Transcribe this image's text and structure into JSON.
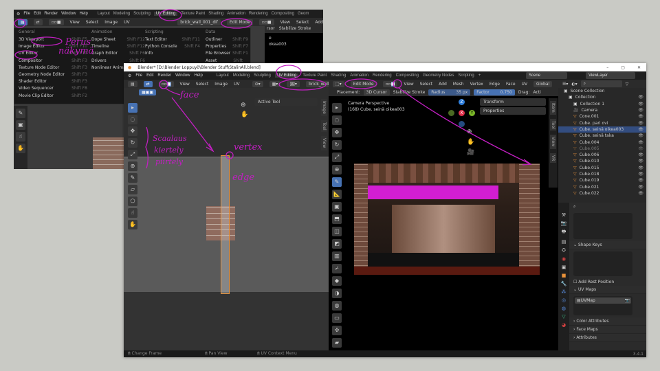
{
  "back_window": {
    "menu": [
      "File",
      "Edit",
      "Render",
      "Window",
      "Help"
    ],
    "workspaces": [
      "Layout",
      "Modeling",
      "Sculpting",
      "UV Editing",
      "Texture Paint",
      "Shading",
      "Animation",
      "Rendering",
      "Compositing",
      "Geom"
    ],
    "header": {
      "items": [
        "View",
        "Select",
        "Image",
        "UV"
      ],
      "image_name": "brick_wall_001_dif",
      "mode": "Edit Mode",
      "right_items": [
        "View",
        "Select",
        "Add"
      ],
      "cursor_text": "rsor",
      "stabilize": "Stabilize Stroke",
      "scene_text": [
        "e",
        "okea003"
      ]
    },
    "editor_menu": {
      "columns": [
        {
          "heading": "General",
          "items": [
            [
              "3D Viewport",
              "Shift F5"
            ],
            [
              "Image Editor",
              "Shift F10"
            ],
            [
              "UV Editor",
              "Shift F10"
            ],
            [
              "Compositor",
              "Shift F3"
            ],
            [
              "Texture Node Editor",
              "Shift F3"
            ],
            [
              "Geometry Node Editor",
              "Shift F3"
            ],
            [
              "Shader Editor",
              "Shift F3"
            ],
            [
              "Video Sequencer",
              "Shift F8"
            ],
            [
              "Movie Clip Editor",
              "Shift F2"
            ]
          ]
        },
        {
          "heading": "Animation",
          "items": [
            [
              "Dope Sheet",
              "Shift F12"
            ],
            [
              "Timeline",
              "Shift F12"
            ],
            [
              "Graph Editor",
              "Shift F6"
            ],
            [
              "Drivers",
              "Shift F6"
            ],
            [
              "Nonlinear Animation",
              ""
            ]
          ]
        },
        {
          "heading": "Scripting",
          "items": [
            [
              "Text Editor",
              "Shift F11"
            ],
            [
              "Python Console",
              "Shift F4"
            ],
            [
              "Info",
              ""
            ]
          ]
        },
        {
          "heading": "Data",
          "items": [
            [
              "Outliner",
              "Shift F9"
            ],
            [
              "Properties",
              "Shift F7"
            ],
            [
              "File Browser",
              "Shift F1"
            ],
            [
              "Asset Browser",
              "Shift F1"
            ]
          ]
        }
      ]
    }
  },
  "front_window": {
    "title": "Blender* [D:\\Blender Loppuyö\\Blender Stuff\\StalinAll.blend]",
    "menu": [
      "File",
      "Edit",
      "Render",
      "Window",
      "Help"
    ],
    "workspaces": [
      "Layout",
      "Modeling",
      "Sculpting",
      "UV Editing",
      "Texture Paint",
      "Shading",
      "Animation",
      "Rendering",
      "Compositing",
      "Geometry Nodes",
      "Scripting",
      "+"
    ],
    "active_workspace": "UV Editing",
    "scene": "Scene",
    "view_layer": "ViewLayer",
    "uv_editor": {
      "menu": [
        "View",
        "Select",
        "Image",
        "UV"
      ],
      "image_name": "brick_wall_001_dif",
      "active_tool": "Active Tool",
      "side_tabs": [
        "Image",
        "Tool",
        "View"
      ]
    },
    "viewport": {
      "mode": "Edit Mode",
      "menu": [
        "View",
        "Select",
        "Add",
        "Mesh",
        "Vertex",
        "Edge",
        "Face",
        "UV"
      ],
      "orientation": "Global",
      "placement_label": "Placement:",
      "placement_value": "3D Cursor",
      "stabilize": "Stabilize Stroke",
      "radius_label": "Radius",
      "radius_value": "35 px",
      "factor_label": "Factor",
      "factor_value": "0.750",
      "drag_label": "Drag:",
      "drag_value": "Acti",
      "camera_label": "Camera Perspective",
      "object_label": "(168) Cube. seinä oikea003",
      "panels": [
        "Transform",
        "Properties"
      ],
      "side_tabs": [
        "Item",
        "Tool",
        "View",
        "VR"
      ],
      "gizmo": {
        "x": "X",
        "y": "Y",
        "z": "Z"
      }
    },
    "outliner": {
      "scene_collection": "Scene Collection",
      "rows": [
        {
          "name": "Collection",
          "indent": 1,
          "type": "collection"
        },
        {
          "name": "Collection 1",
          "indent": 2,
          "type": "collection"
        },
        {
          "name": "Camera",
          "indent": 2,
          "type": "camera"
        },
        {
          "name": "Cone.001",
          "indent": 2,
          "type": "mesh"
        },
        {
          "name": "Cube. pari ovi",
          "indent": 2,
          "type": "mesh"
        },
        {
          "name": "Cube. seinä oikea003",
          "indent": 2,
          "type": "mesh",
          "selected": true
        },
        {
          "name": "Cube. seinä taka",
          "indent": 2,
          "type": "mesh"
        },
        {
          "name": "Cube.004",
          "indent": 2,
          "type": "mesh"
        },
        {
          "name": "Cube.005",
          "indent": 2,
          "type": "mesh",
          "hidden": true
        },
        {
          "name": "Cube.006",
          "indent": 2,
          "type": "mesh"
        },
        {
          "name": "Cube.010",
          "indent": 2,
          "type": "mesh"
        },
        {
          "name": "Cube.015",
          "indent": 2,
          "type": "mesh"
        },
        {
          "name": "Cube.018",
          "indent": 2,
          "type": "mesh"
        },
        {
          "name": "Cube.019",
          "indent": 2,
          "type": "mesh"
        },
        {
          "name": "Cube.021",
          "indent": 2,
          "type": "mesh"
        },
        {
          "name": "Cube.022",
          "indent": 2,
          "type": "mesh"
        }
      ]
    },
    "properties": {
      "shape_keys": "Shape Keys",
      "add_rest": "Add Rest Position",
      "uv_maps": "UV Maps",
      "uv_map_item": "UVMap",
      "sections": [
        "Color Attributes",
        "Face Maps",
        "Attributes"
      ]
    },
    "status": {
      "items": [
        "Change Frame",
        "Pan View",
        "UV Context Menu"
      ],
      "version": "3.4.1"
    }
  },
  "annotations": {
    "perus": "Perus",
    "nakyma": "näkymä",
    "face": "face",
    "vertex": "vertex",
    "edge": "edge",
    "tools": [
      "Scaalaus",
      "kiertely",
      "piirtely"
    ]
  },
  "colors": {
    "accent": "#4772b3",
    "annotation": "#c21fc2",
    "selected_row": "#334d80",
    "uv_edge": "#e8923a"
  }
}
